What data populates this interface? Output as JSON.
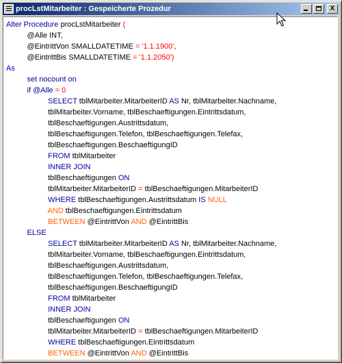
{
  "window": {
    "title": "procLstMitarbeiter : Gespeicherte Prozedur",
    "min_label": "_",
    "close_label": "X"
  },
  "code_lines": [
    [
      {
        "t": "Alter Procedure",
        "c": "kw"
      },
      {
        "t": " procLstMitarbeiter ",
        "c": "txt"
      },
      {
        "t": "(",
        "c": "op"
      }
    ],
    [
      {
        "t": "\t@Alle INT,",
        "c": "txt"
      }
    ],
    [
      {
        "t": "\t@EintrittVon SMALLDATETIME ",
        "c": "txt"
      },
      {
        "t": "=",
        "c": "op"
      },
      {
        "t": " '1.1.1900'",
        "c": "str"
      },
      {
        "t": ",",
        "c": "txt"
      }
    ],
    [
      {
        "t": "\t@EintrittBis SMALLDATETIME ",
        "c": "txt"
      },
      {
        "t": "=",
        "c": "op"
      },
      {
        "t": " '1.1.2050'",
        "c": "str"
      },
      {
        "t": ")",
        "c": "op"
      }
    ],
    [
      {
        "t": "As",
        "c": "kw"
      }
    ],
    [
      {
        "t": "\tset nocount on",
        "c": "kw"
      }
    ],
    [
      {
        "t": "\tif @Alle ",
        "c": "kw"
      },
      {
        "t": "=",
        "c": "op"
      },
      {
        "t": " 0",
        "c": "str"
      }
    ],
    [
      {
        "t": "\t\tSELECT",
        "c": "kw"
      },
      {
        "t": " tblMitarbeiter.MitarbeiterID ",
        "c": "txt"
      },
      {
        "t": "AS",
        "c": "kw"
      },
      {
        "t": " Nr, tblMitarbeiter.Nachname,",
        "c": "txt"
      }
    ],
    [
      {
        "t": "\t\ttblMitarbeiter.Vorname, tblBeschaeftigungen.Eintrittsdatum,",
        "c": "txt"
      }
    ],
    [
      {
        "t": "\t\ttblBeschaeftigungen.Austrittsdatum,",
        "c": "txt"
      }
    ],
    [
      {
        "t": "\t\ttblBeschaeftigungen.Telefon, tblBeschaeftigungen.Telefax,",
        "c": "txt"
      }
    ],
    [
      {
        "t": "\t\ttblBeschaeftigungen.BeschaeftigungID",
        "c": "txt"
      }
    ],
    [
      {
        "t": "\t\tFROM",
        "c": "kw"
      },
      {
        "t": " tblMitarbeiter",
        "c": "txt"
      }
    ],
    [
      {
        "t": "\t\tINNER JOIN",
        "c": "kw"
      }
    ],
    [
      {
        "t": "\t\ttblBeschaeftigungen ",
        "c": "txt"
      },
      {
        "t": "ON",
        "c": "kw"
      }
    ],
    [
      {
        "t": "\t\ttblMitarbeiter.MitarbeiterID ",
        "c": "txt"
      },
      {
        "t": "=",
        "c": "op"
      },
      {
        "t": " tblBeschaeftigungen.MitarbeiterID",
        "c": "txt"
      }
    ],
    [
      {
        "t": "\t\tWHERE",
        "c": "kw"
      },
      {
        "t": " tblBeschaeftigungen.Austrittsdatum ",
        "c": "txt"
      },
      {
        "t": "IS",
        "c": "kw"
      },
      {
        "t": " NULL",
        "c": "cmp"
      }
    ],
    [
      {
        "t": "\t\tAND",
        "c": "cmp"
      },
      {
        "t": " tblBeschaeftigungen.Eintrittsdatum",
        "c": "txt"
      }
    ],
    [
      {
        "t": "\t\tBETWEEN",
        "c": "cmp"
      },
      {
        "t": " @EintrittVon ",
        "c": "txt"
      },
      {
        "t": "AND",
        "c": "cmp"
      },
      {
        "t": " @EintrittBis",
        "c": "txt"
      }
    ],
    [
      {
        "t": "\tELSE",
        "c": "kw"
      }
    ],
    [
      {
        "t": "\t\tSELECT",
        "c": "kw"
      },
      {
        "t": " tblMitarbeiter.MitarbeiterID ",
        "c": "txt"
      },
      {
        "t": "AS",
        "c": "kw"
      },
      {
        "t": " Nr, tblMitarbeiter.Nachname,",
        "c": "txt"
      }
    ],
    [
      {
        "t": "\t\ttblMitarbeiter.Vorname, tblBeschaeftigungen.Eintrittsdatum,",
        "c": "txt"
      }
    ],
    [
      {
        "t": "\t\ttblBeschaeftigungen.Austrittsdatum,",
        "c": "txt"
      }
    ],
    [
      {
        "t": "\t\ttblBeschaeftigungen.Telefon, tblBeschaeftigungen.Telefax,",
        "c": "txt"
      }
    ],
    [
      {
        "t": "\t\ttblBeschaeftigungen.BeschaeftigungID",
        "c": "txt"
      }
    ],
    [
      {
        "t": "\t\tFROM",
        "c": "kw"
      },
      {
        "t": " tblMitarbeiter",
        "c": "txt"
      }
    ],
    [
      {
        "t": "\t\tINNER JOIN",
        "c": "kw"
      }
    ],
    [
      {
        "t": "\t\ttblBeschaeftigungen ",
        "c": "txt"
      },
      {
        "t": "ON",
        "c": "kw"
      }
    ],
    [
      {
        "t": "\t\ttblMitarbeiter.MitarbeiterID ",
        "c": "txt"
      },
      {
        "t": "=",
        "c": "op"
      },
      {
        "t": " tblBeschaeftigungen.MitarbeiterID",
        "c": "txt"
      }
    ],
    [
      {
        "t": "\t\tWHERE",
        "c": "kw"
      },
      {
        "t": " tblBeschaeftigungen.Eintrittsdatum",
        "c": "txt"
      }
    ],
    [
      {
        "t": "\t\tBETWEEN",
        "c": "cmp"
      },
      {
        "t": " @EintrittVon ",
        "c": "txt"
      },
      {
        "t": "AND",
        "c": "cmp"
      },
      {
        "t": " @EintrittBis",
        "c": "txt"
      }
    ]
  ],
  "colors": {
    "keyword": "#0000a0",
    "string": "#ff0000",
    "operator_orange": "#ff6000",
    "titlebar_start": "#0a246a",
    "titlebar_end": "#a6caf0"
  }
}
